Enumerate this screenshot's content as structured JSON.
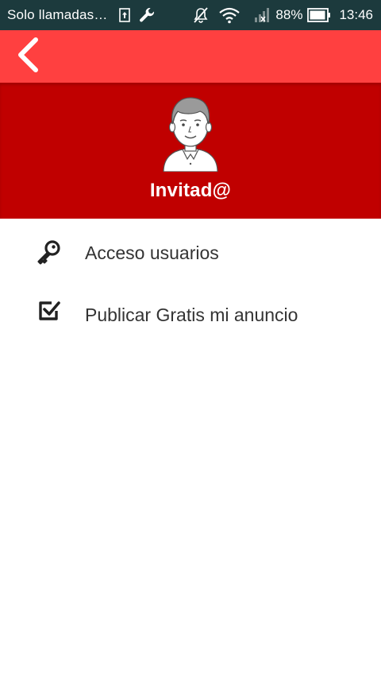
{
  "status_bar": {
    "carrier": "Solo llamadas…",
    "battery": "88%",
    "time": "13:46",
    "icons": [
      "upload-icon",
      "wrench-icon",
      "mute-icon",
      "wifi-icon",
      "signal-icon",
      "battery-icon"
    ]
  },
  "app_bar": {
    "back_icon": "chevron-left-icon",
    "color": "#ff4040"
  },
  "profile": {
    "name": "Invitad@",
    "avatar_icon": "user-avatar",
    "color": "#c00000"
  },
  "menu": {
    "items": [
      {
        "label": "Acceso usuarios",
        "icon": "key-icon"
      },
      {
        "label": "Publicar Gratis mi anuncio",
        "icon": "checkbox-icon"
      }
    ]
  }
}
